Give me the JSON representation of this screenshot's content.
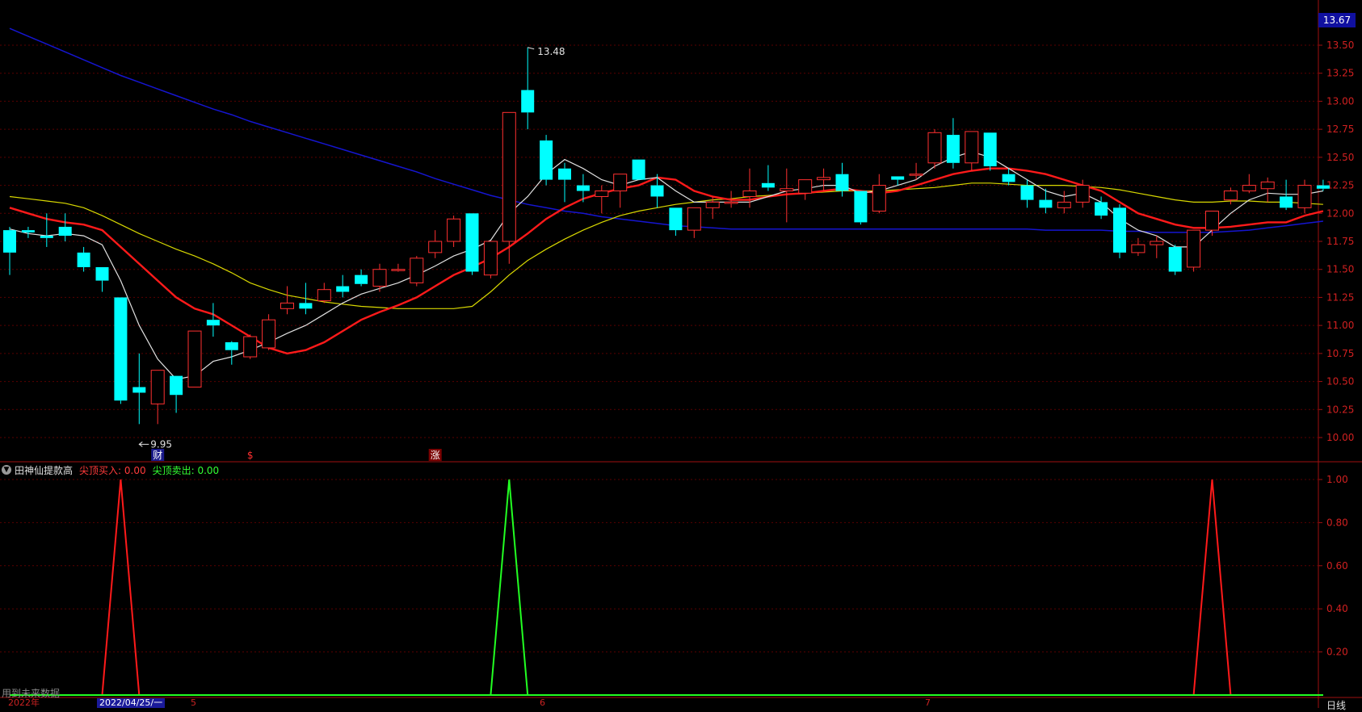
{
  "main_chart": {
    "price_box": "13.67",
    "y_ticks": [
      "13.50",
      "13.25",
      "13.00",
      "12.75",
      "12.50",
      "12.25",
      "12.00",
      "11.75",
      "11.50",
      "11.25",
      "11.00",
      "10.75",
      "10.50",
      "10.25",
      "10.00"
    ],
    "high_label": "13.48",
    "low_label": "9.95",
    "event_markers": [
      "财",
      "$",
      "涨"
    ]
  },
  "indicator": {
    "name": "田神仙提款高",
    "buy_label": "尖顶买入: 0.00",
    "sell_label": "尖顶卖出: 0.00",
    "y_ticks": [
      "1.00",
      "0.80",
      "0.60",
      "0.40",
      "0.20"
    ]
  },
  "bottom": {
    "future_note": "用到未来数据",
    "year_label": "2022年",
    "date_cursor": "2022/04/25/一",
    "month_labels": [
      "5",
      "6",
      "7"
    ],
    "period": "日线"
  },
  "chart_data": {
    "type": "candlestick",
    "y_range": [
      9.8,
      13.7
    ],
    "candles": [
      [
        11.85,
        11.65,
        11.88,
        11.45
      ],
      [
        11.85,
        11.83,
        11.88,
        11.78
      ],
      [
        11.8,
        11.78,
        12.0,
        11.7
      ],
      [
        11.88,
        11.8,
        12.0,
        11.75
      ],
      [
        11.65,
        11.52,
        11.7,
        11.48
      ],
      [
        11.52,
        11.4,
        11.52,
        11.3
      ],
      [
        11.25,
        10.33,
        11.25,
        10.3
      ],
      [
        10.45,
        10.4,
        10.75,
        10.12
      ],
      [
        10.3,
        10.6,
        10.6,
        10.12
      ],
      [
        10.55,
        10.38,
        10.55,
        10.22
      ],
      [
        10.45,
        10.95,
        10.95,
        10.45
      ],
      [
        11.05,
        11.0,
        11.2,
        10.9
      ],
      [
        10.85,
        10.78,
        10.86,
        10.65
      ],
      [
        10.72,
        10.9,
        10.92,
        10.7
      ],
      [
        10.8,
        11.05,
        11.1,
        10.78
      ],
      [
        11.15,
        11.2,
        11.35,
        11.1
      ],
      [
        11.2,
        11.15,
        11.38,
        11.1
      ],
      [
        11.22,
        11.32,
        11.38,
        11.2
      ],
      [
        11.35,
        11.3,
        11.45,
        11.25
      ],
      [
        11.45,
        11.37,
        11.5,
        11.35
      ],
      [
        11.35,
        11.5,
        11.55,
        11.3
      ],
      [
        11.5,
        11.5,
        11.55,
        11.48
      ],
      [
        11.38,
        11.6,
        11.62,
        11.35
      ],
      [
        11.65,
        11.75,
        11.85,
        11.6
      ],
      [
        11.75,
        11.95,
        11.98,
        11.7
      ],
      [
        12.0,
        11.48,
        12.0,
        11.45
      ],
      [
        11.45,
        11.75,
        11.75,
        11.42
      ],
      [
        11.75,
        12.9,
        12.9,
        11.55
      ],
      [
        13.1,
        12.9,
        13.48,
        12.75
      ],
      [
        12.65,
        12.3,
        12.7,
        12.25
      ],
      [
        12.4,
        12.3,
        12.45,
        12.1
      ],
      [
        12.25,
        12.2,
        12.35,
        12.1
      ],
      [
        12.15,
        12.2,
        12.25,
        12.0
      ],
      [
        12.2,
        12.35,
        12.35,
        12.05
      ],
      [
        12.48,
        12.3,
        12.48,
        12.3
      ],
      [
        12.25,
        12.15,
        12.35,
        12.05
      ],
      [
        12.05,
        11.85,
        12.05,
        11.8
      ],
      [
        11.85,
        12.05,
        12.05,
        11.78
      ],
      [
        12.05,
        12.1,
        12.15,
        11.95
      ],
      [
        12.1,
        12.1,
        12.2,
        12.05
      ],
      [
        12.15,
        12.2,
        12.4,
        12.05
      ],
      [
        12.27,
        12.23,
        12.43,
        12.2
      ],
      [
        12.2,
        12.22,
        12.4,
        11.92
      ],
      [
        12.18,
        12.3,
        12.3,
        12.12
      ],
      [
        12.3,
        12.32,
        12.4,
        12.2
      ],
      [
        12.35,
        12.2,
        12.45,
        12.15
      ],
      [
        12.2,
        11.92,
        12.2,
        11.9
      ],
      [
        12.02,
        12.25,
        12.35,
        12.0
      ],
      [
        12.33,
        12.3,
        12.33,
        12.25
      ],
      [
        12.35,
        12.35,
        12.45,
        12.3
      ],
      [
        12.45,
        12.72,
        12.75,
        12.4
      ],
      [
        12.7,
        12.45,
        12.85,
        12.4
      ],
      [
        12.45,
        12.73,
        12.73,
        12.38
      ],
      [
        12.72,
        12.42,
        12.72,
        12.38
      ],
      [
        12.35,
        12.28,
        12.4,
        12.25
      ],
      [
        12.25,
        12.12,
        12.3,
        12.05
      ],
      [
        12.12,
        12.05,
        12.22,
        12.0
      ],
      [
        12.05,
        12.1,
        12.2,
        12.0
      ],
      [
        12.1,
        12.25,
        12.3,
        12.05
      ],
      [
        12.1,
        11.98,
        12.15,
        11.95
      ],
      [
        12.05,
        11.65,
        12.08,
        11.6
      ],
      [
        11.65,
        11.72,
        11.78,
        11.62
      ],
      [
        11.72,
        11.75,
        11.8,
        11.6
      ],
      [
        11.7,
        11.48,
        11.72,
        11.45
      ],
      [
        11.52,
        11.85,
        11.85,
        11.48
      ],
      [
        11.85,
        12.02,
        12.02,
        11.8
      ],
      [
        12.12,
        12.2,
        12.23,
        12.08
      ],
      [
        12.2,
        12.25,
        12.35,
        12.18
      ],
      [
        12.22,
        12.28,
        12.32,
        12.1
      ],
      [
        12.15,
        12.05,
        12.3,
        12.03
      ],
      [
        12.05,
        12.25,
        12.3,
        12.0
      ],
      [
        12.25,
        12.22,
        12.3,
        12.2
      ]
    ],
    "ma_white": [
      11.86,
      11.82,
      11.8,
      11.82,
      11.8,
      11.72,
      11.4,
      11.0,
      10.7,
      10.52,
      10.55,
      10.68,
      10.72,
      10.78,
      10.85,
      10.93,
      11.0,
      11.1,
      11.2,
      11.28,
      11.33,
      11.38,
      11.45,
      11.53,
      11.62,
      11.68,
      11.76,
      12.0,
      12.15,
      12.35,
      12.48,
      12.4,
      12.3,
      12.25,
      12.3,
      12.32,
      12.2,
      12.1,
      12.1,
      12.1,
      12.1,
      12.15,
      12.2,
      12.22,
      12.25,
      12.25,
      12.18,
      12.2,
      12.25,
      12.3,
      12.42,
      12.5,
      12.55,
      12.5,
      12.4,
      12.3,
      12.2,
      12.15,
      12.18,
      12.1,
      11.95,
      11.85,
      11.8,
      11.7,
      11.7,
      11.85,
      12.0,
      12.12,
      12.18,
      12.17,
      12.17,
      12.2
    ],
    "ma_red": [
      12.05,
      12.0,
      11.95,
      11.92,
      11.9,
      11.85,
      11.7,
      11.55,
      11.4,
      11.25,
      11.15,
      11.1,
      11.0,
      10.9,
      10.8,
      10.75,
      10.78,
      10.85,
      10.95,
      11.05,
      11.12,
      11.18,
      11.25,
      11.35,
      11.45,
      11.52,
      11.6,
      11.7,
      11.82,
      11.95,
      12.05,
      12.13,
      12.18,
      12.22,
      12.25,
      12.32,
      12.3,
      12.2,
      12.15,
      12.12,
      12.12,
      12.15,
      12.17,
      12.18,
      12.2,
      12.22,
      12.2,
      12.18,
      12.2,
      12.25,
      12.3,
      12.35,
      12.38,
      12.4,
      12.4,
      12.38,
      12.35,
      12.3,
      12.25,
      12.2,
      12.1,
      12.0,
      11.95,
      11.9,
      11.87,
      11.87,
      11.88,
      11.9,
      11.92,
      11.92,
      11.98,
      12.02
    ],
    "ma_yellow": [
      12.15,
      12.13,
      12.11,
      12.09,
      12.05,
      11.98,
      11.9,
      11.82,
      11.75,
      11.68,
      11.62,
      11.55,
      11.47,
      11.38,
      11.32,
      11.27,
      11.24,
      11.21,
      11.19,
      11.17,
      11.16,
      11.15,
      11.15,
      11.15,
      11.15,
      11.17,
      11.3,
      11.45,
      11.58,
      11.68,
      11.77,
      11.85,
      11.92,
      11.98,
      12.02,
      12.05,
      12.08,
      12.1,
      12.12,
      12.13,
      12.15,
      12.16,
      12.17,
      12.18,
      12.19,
      12.2,
      12.2,
      12.2,
      12.21,
      12.22,
      12.23,
      12.25,
      12.27,
      12.27,
      12.26,
      12.25,
      12.25,
      12.25,
      12.24,
      12.23,
      12.21,
      12.18,
      12.15,
      12.12,
      12.1,
      12.1,
      12.11,
      12.11,
      12.1,
      12.1,
      12.09,
      12.08
    ],
    "ma_blue": [
      13.65,
      13.58,
      13.51,
      13.44,
      13.37,
      13.3,
      13.23,
      13.17,
      13.11,
      13.05,
      12.99,
      12.93,
      12.88,
      12.82,
      12.77,
      12.72,
      12.67,
      12.62,
      12.57,
      12.52,
      12.47,
      12.42,
      12.37,
      12.31,
      12.26,
      12.21,
      12.16,
      12.12,
      12.08,
      12.05,
      12.02,
      12.0,
      11.97,
      11.95,
      11.93,
      11.91,
      11.89,
      11.88,
      11.87,
      11.86,
      11.86,
      11.86,
      11.86,
      11.86,
      11.86,
      11.86,
      11.86,
      11.86,
      11.86,
      11.86,
      11.86,
      11.86,
      11.86,
      11.86,
      11.86,
      11.86,
      11.85,
      11.85,
      11.85,
      11.85,
      11.84,
      11.84,
      11.83,
      11.83,
      11.83,
      11.83,
      11.84,
      11.85,
      11.87,
      11.89,
      11.91,
      11.93
    ],
    "indicator_buy": [
      0,
      0,
      0,
      0,
      0,
      0,
      1,
      0,
      0,
      0,
      0,
      0,
      0,
      0,
      0,
      0,
      0,
      0,
      0,
      0,
      0,
      0,
      0,
      0,
      0,
      0,
      0,
      0,
      0,
      0,
      0,
      0,
      0,
      0,
      0,
      0,
      0,
      0,
      0,
      0,
      0,
      0,
      0,
      0,
      0,
      0,
      0,
      0,
      0,
      0,
      0,
      0,
      0,
      0,
      0,
      0,
      0,
      0,
      0,
      0,
      0,
      0,
      0,
      0,
      0,
      1,
      0,
      0,
      0,
      0,
      0,
      0
    ],
    "indicator_sell": [
      0,
      0,
      0,
      0,
      0,
      0,
      0,
      0,
      0,
      0,
      0,
      0,
      0,
      0,
      0,
      0,
      0,
      0,
      0,
      0,
      0,
      0,
      0,
      0,
      0,
      0,
      0,
      1,
      0,
      0,
      0,
      0,
      0,
      0,
      0,
      0,
      0,
      0,
      0,
      0,
      0,
      0,
      0,
      0,
      0,
      0,
      0,
      0,
      0,
      0,
      0,
      0,
      0,
      0,
      0,
      0,
      0,
      0,
      0,
      0,
      0,
      0,
      0,
      0,
      0,
      0,
      0,
      0,
      0,
      0,
      0,
      0
    ],
    "colors": {
      "up": "#ff3030",
      "down": "#00ffff",
      "ma_white": "#e0e0e0",
      "ma_red": "#ff1a1a",
      "ma_yellow": "#d8d800",
      "ma_blue": "#1515d0",
      "buy": "#ff1a1a",
      "sell": "#22ff22",
      "grid": "#5a0000",
      "axis": "#a01010",
      "tick": "#d02020"
    }
  }
}
